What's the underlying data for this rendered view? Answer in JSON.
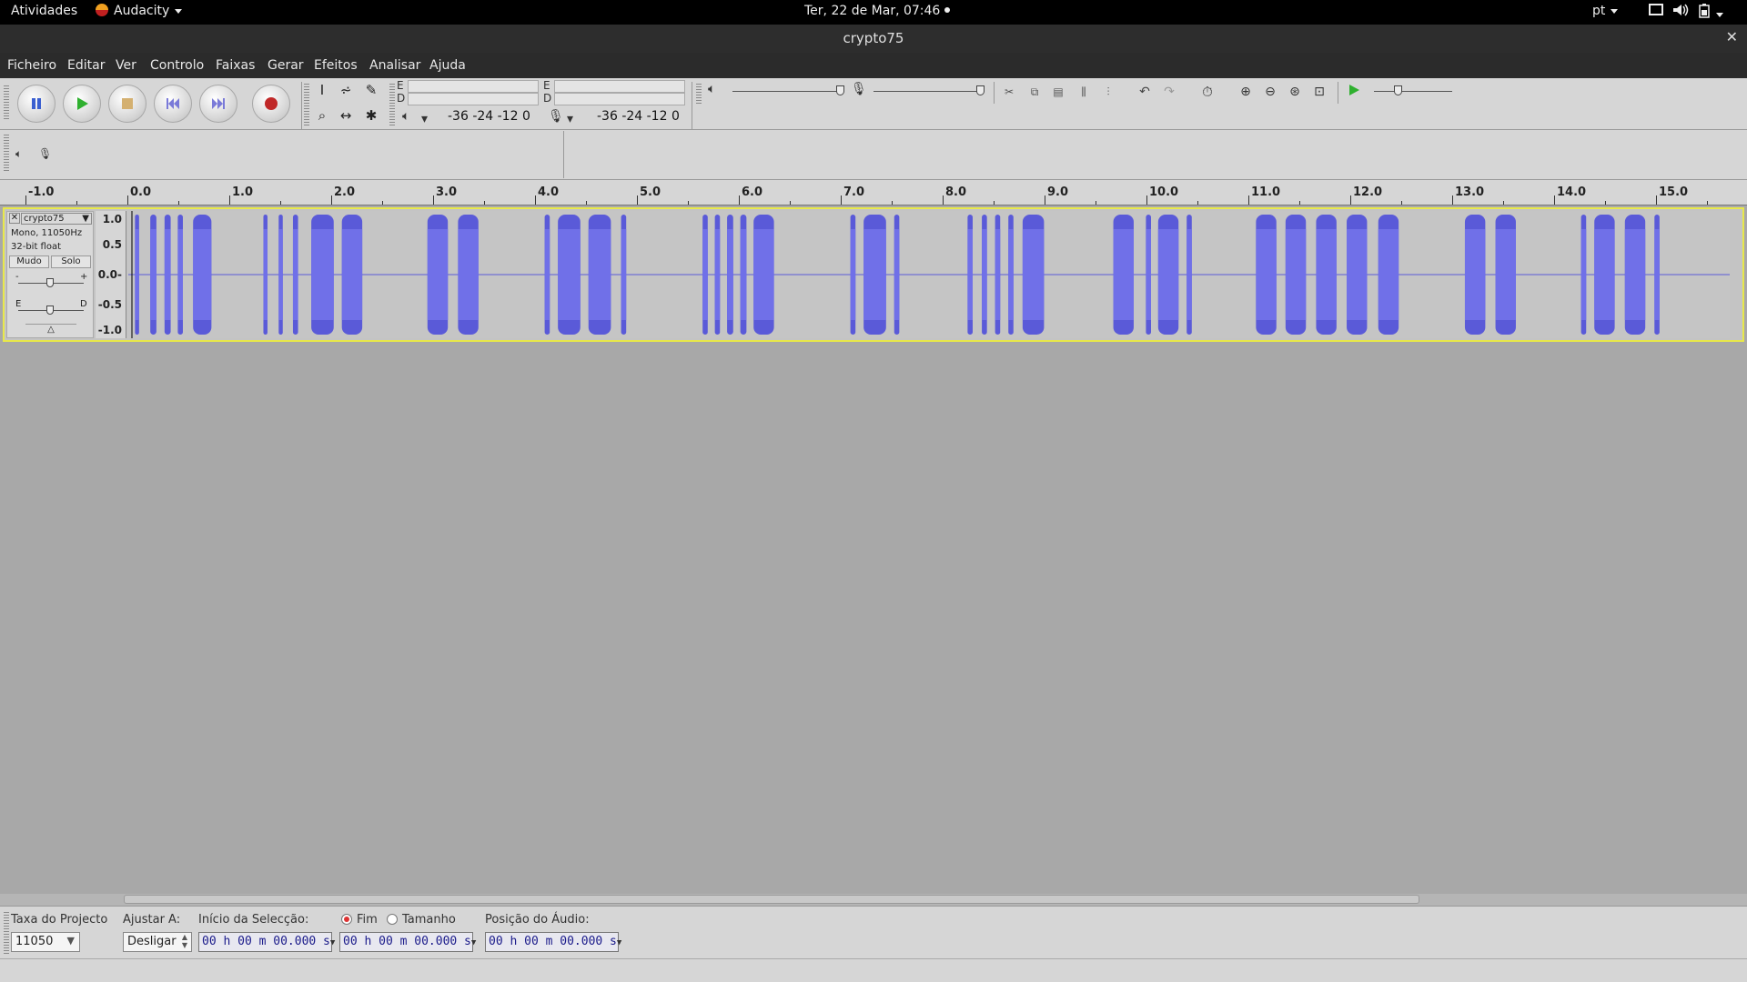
{
  "topbar": {
    "activities": "Atividades",
    "app_name": "Audacity",
    "clock": "Ter, 22 de Mar, 07:46",
    "lang": "pt"
  },
  "window": {
    "title": "crypto75"
  },
  "menu": {
    "items": [
      "Ficheiro",
      "Editar",
      "Ver",
      "Controlo",
      "Faixas",
      "Gerar",
      "Efeitos",
      "Analisar",
      "Ajuda"
    ]
  },
  "meters": {
    "play_left": "E",
    "play_right": "D",
    "rec_left": "E",
    "rec_right": "D",
    "play_scale": "-36 -24 -12 0",
    "rec_scale": "-36 -24 -12 0"
  },
  "ruler": {
    "labels": [
      "-1.0",
      "0.0",
      "1.0",
      "2.0",
      "3.0",
      "4.0",
      "5.0",
      "6.0",
      "7.0",
      "8.0",
      "9.0",
      "10.0",
      "11.0",
      "12.0",
      "13.0",
      "14.0",
      "15.0"
    ]
  },
  "track": {
    "name": "crypto75",
    "format": "Mono, 11050Hz",
    "bit_depth": "32-bit float",
    "mute": "Mudo",
    "solo": "Solo",
    "gain_minus": "-",
    "gain_plus": "+",
    "pan_left": "E",
    "pan_right": "D",
    "scale": [
      "1.0",
      "0.5",
      "0.0-",
      "-0.5",
      "-1.0"
    ],
    "wave_color": "#5a5ad8",
    "bursts_seconds": [
      [
        0.03,
        0.07
      ],
      [
        0.18,
        0.24
      ],
      [
        0.32,
        0.38
      ],
      [
        0.45,
        0.5
      ],
      [
        0.6,
        0.78
      ],
      [
        1.29,
        1.33
      ],
      [
        1.44,
        1.48
      ],
      [
        1.58,
        1.63
      ],
      [
        1.76,
        1.98
      ],
      [
        2.06,
        2.26
      ],
      [
        2.9,
        3.1
      ],
      [
        3.2,
        3.4
      ],
      [
        4.05,
        4.1
      ],
      [
        4.18,
        4.4
      ],
      [
        4.48,
        4.7
      ],
      [
        4.8,
        4.85
      ],
      [
        5.6,
        5.65
      ],
      [
        5.72,
        5.77
      ],
      [
        5.84,
        5.9
      ],
      [
        5.97,
        6.03
      ],
      [
        6.1,
        6.3
      ],
      [
        7.05,
        7.1
      ],
      [
        7.18,
        7.4
      ],
      [
        7.48,
        7.53
      ],
      [
        8.2,
        8.25
      ],
      [
        8.34,
        8.39
      ],
      [
        8.47,
        8.52
      ],
      [
        8.6,
        8.65
      ],
      [
        8.74,
        8.95
      ],
      [
        9.63,
        9.83
      ],
      [
        9.95,
        10.0
      ],
      [
        10.07,
        10.27
      ],
      [
        10.35,
        10.4
      ],
      [
        11.03,
        11.23
      ],
      [
        11.32,
        11.52
      ],
      [
        11.62,
        11.82
      ],
      [
        11.92,
        12.12
      ],
      [
        12.23,
        12.43
      ],
      [
        13.08,
        13.28
      ],
      [
        13.38,
        13.58
      ],
      [
        14.22,
        14.27
      ],
      [
        14.35,
        14.55
      ],
      [
        14.65,
        14.85
      ],
      [
        14.94,
        14.99
      ]
    ]
  },
  "selection": {
    "project_rate_label": "Taxa do Projecto",
    "project_rate": "11050",
    "snap_label": "Ajustar A:",
    "snap_value": "Desligar",
    "sel_start_label": "Início da Selecção:",
    "end_label": "Fim",
    "length_label": "Tamanho",
    "audio_pos_label": "Posição do Áudio:",
    "sel_start": "00 h 00 m 00.000 s",
    "sel_end": "00 h 00 m 00.000 s",
    "audio_pos": "00 h 00 m 00.000 s"
  }
}
